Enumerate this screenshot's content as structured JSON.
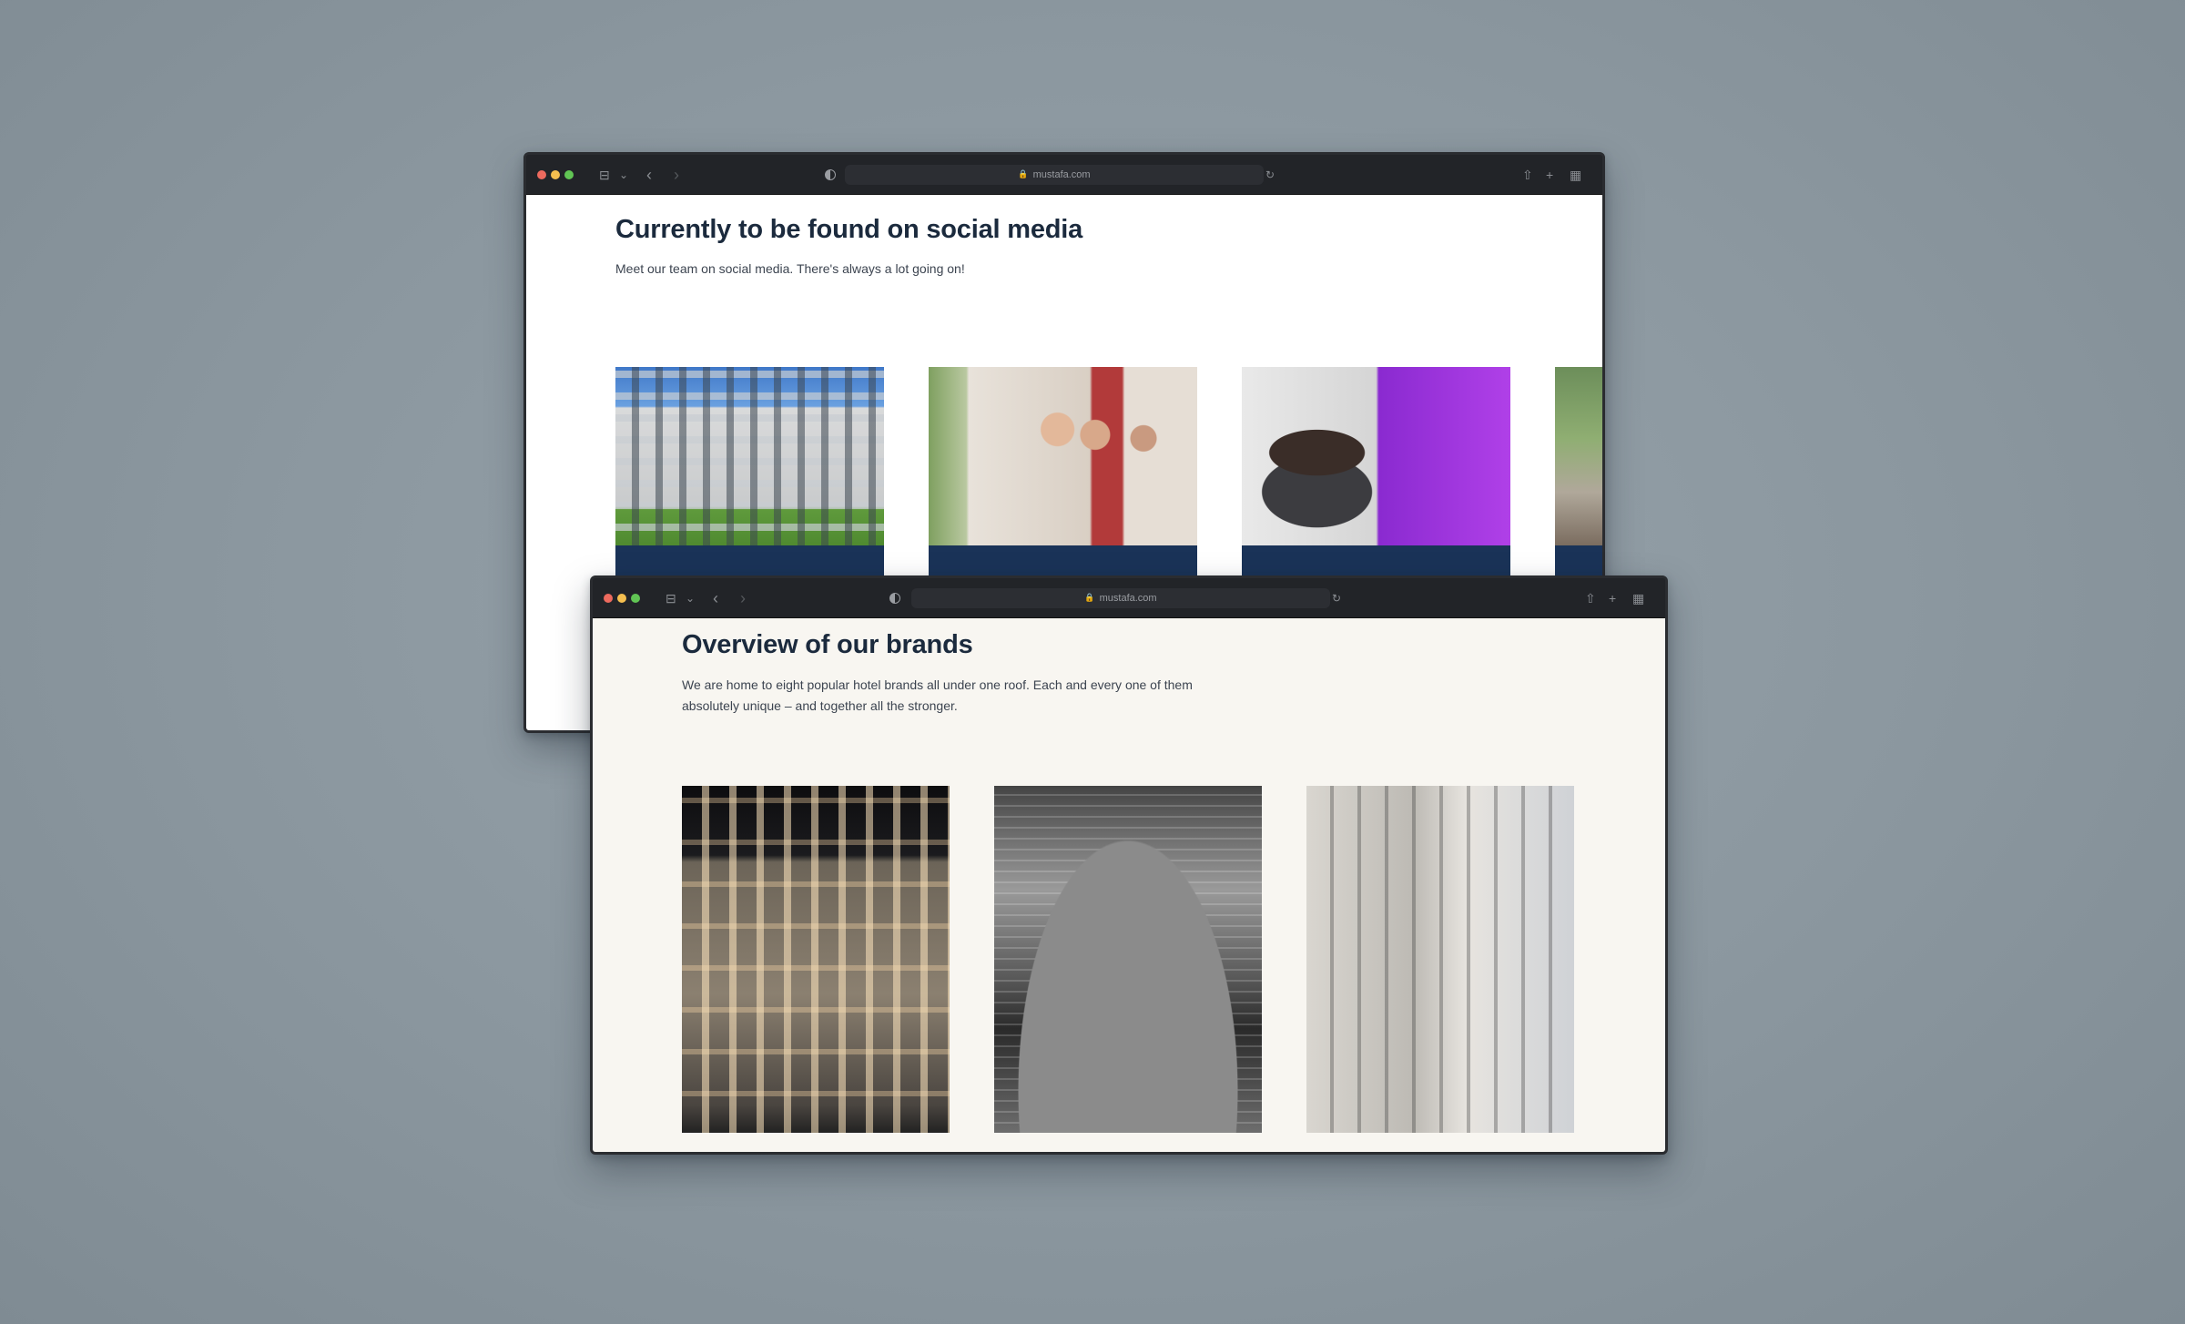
{
  "windows": [
    {
      "url": "mustafa.com",
      "heading": "Currently to be found on social media",
      "subtext": "Meet our team on social media. There's always a lot going on!",
      "cards": [
        {
          "image": "hotel-building-photo"
        },
        {
          "image": "team-meeting-photo"
        },
        {
          "image": "speaker-portrait-photo"
        },
        {
          "image": "partial-card-photo"
        }
      ]
    },
    {
      "url": "mustafa.com",
      "heading": "Overview of our brands",
      "subtext_line1": "We are home to eight popular hotel brands all under one roof. Each and every one of them",
      "subtext_line2": "absolutely unique – and together all the stronger.",
      "cards": [
        {
          "image": "illuminated-facade-photo"
        },
        {
          "image": "grand-hall-photo"
        },
        {
          "image": "modern-entrance-photo"
        }
      ]
    }
  ],
  "icons": {
    "sidebar": "⊟",
    "chevron_down": "⌄",
    "back": "‹",
    "forward": "›",
    "lock": "🔒",
    "reload": "↻",
    "share": "⇧",
    "new_tab": "+",
    "tabs": "▦"
  },
  "colors": {
    "heading": "#1b2a3d",
    "card_band": "#1a3358",
    "backdrop": "#8b979f"
  }
}
